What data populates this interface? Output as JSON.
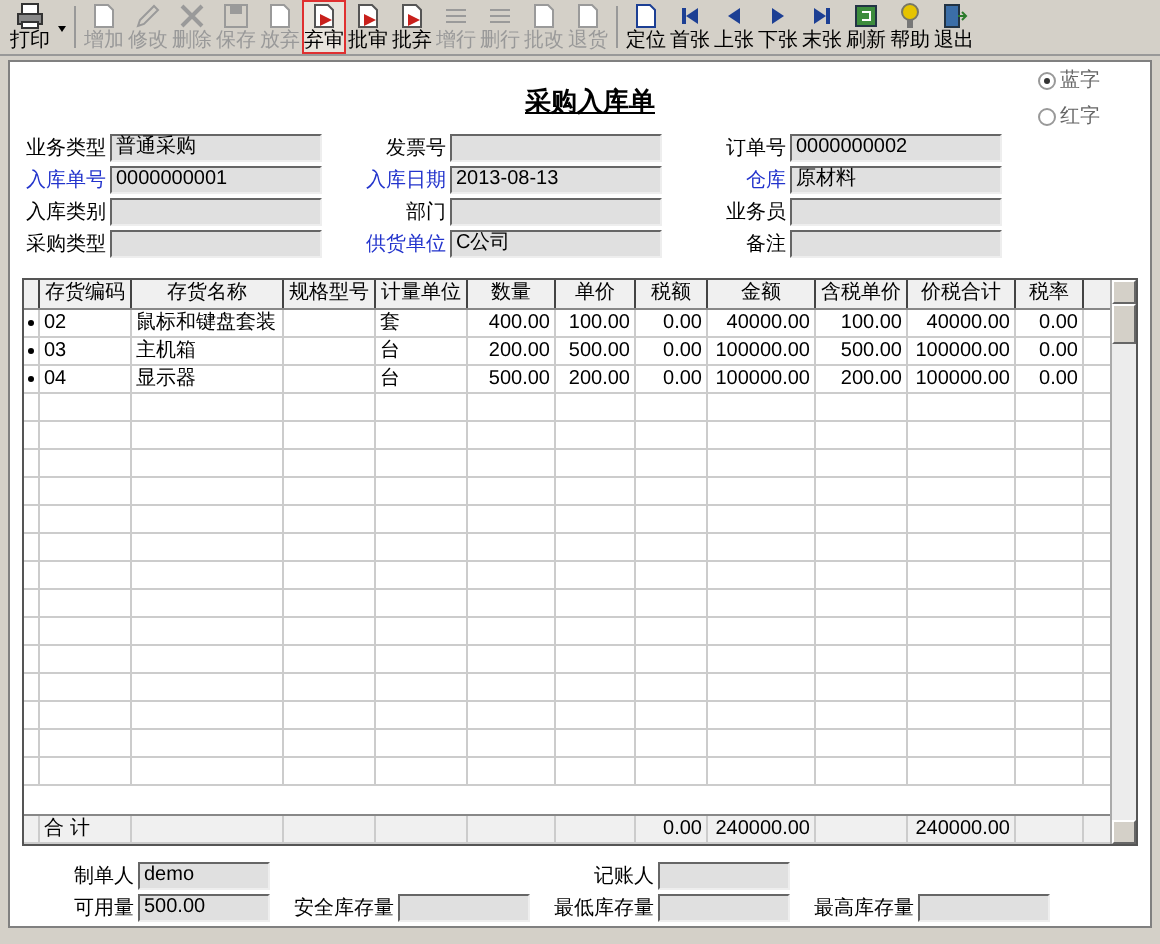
{
  "toolbar": [
    {
      "label": "打印",
      "disabled": false,
      "highlighted": false,
      "dropdown": true
    },
    {
      "label": "增加",
      "disabled": true,
      "highlighted": false,
      "dropdown": false
    },
    {
      "label": "修改",
      "disabled": true,
      "highlighted": false,
      "dropdown": false
    },
    {
      "label": "删除",
      "disabled": true,
      "highlighted": false,
      "dropdown": false
    },
    {
      "label": "保存",
      "disabled": true,
      "highlighted": false,
      "dropdown": false
    },
    {
      "label": "放弃",
      "disabled": true,
      "highlighted": false,
      "dropdown": false
    },
    {
      "label": "弃审",
      "disabled": false,
      "highlighted": true,
      "dropdown": false
    },
    {
      "label": "批审",
      "disabled": false,
      "highlighted": false,
      "dropdown": false
    },
    {
      "label": "批弃",
      "disabled": false,
      "highlighted": false,
      "dropdown": false
    },
    {
      "label": "增行",
      "disabled": true,
      "highlighted": false,
      "dropdown": false
    },
    {
      "label": "删行",
      "disabled": true,
      "highlighted": false,
      "dropdown": false
    },
    {
      "label": "批改",
      "disabled": true,
      "highlighted": false,
      "dropdown": false
    },
    {
      "label": "退货",
      "disabled": true,
      "highlighted": false,
      "dropdown": false
    },
    {
      "label": "定位",
      "disabled": false,
      "highlighted": false,
      "dropdown": false
    },
    {
      "label": "首张",
      "disabled": false,
      "highlighted": false,
      "dropdown": false
    },
    {
      "label": "上张",
      "disabled": false,
      "highlighted": false,
      "dropdown": false
    },
    {
      "label": "下张",
      "disabled": false,
      "highlighted": false,
      "dropdown": false
    },
    {
      "label": "末张",
      "disabled": false,
      "highlighted": false,
      "dropdown": false
    },
    {
      "label": "刷新",
      "disabled": false,
      "highlighted": false,
      "dropdown": false
    },
    {
      "label": "帮助",
      "disabled": false,
      "highlighted": false,
      "dropdown": false
    },
    {
      "label": "退出",
      "disabled": false,
      "highlighted": false,
      "dropdown": false
    }
  ],
  "form": {
    "title": "采购入库单",
    "color_options": [
      {
        "label": "蓝字",
        "selected": true
      },
      {
        "label": "红字",
        "selected": false
      }
    ],
    "fields": [
      {
        "label": "业务类型",
        "value": "普通采购",
        "required": false
      },
      {
        "label": "发票号",
        "required": false
      },
      {
        "label": "订单号",
        "value": "0000000002",
        "required": false
      },
      {
        "label": "入库单号",
        "value": "0000000001",
        "required": true
      },
      {
        "label": "入库日期",
        "value": "2013-08-13",
        "required": true
      },
      {
        "label": "仓库",
        "value": "原材料",
        "required": true
      },
      {
        "label": "入库类别",
        "required": false
      },
      {
        "label": "部门",
        "required": false
      },
      {
        "label": "业务员",
        "required": false
      },
      {
        "label": "采购类型",
        "required": false
      },
      {
        "label": "供货单位",
        "value": "C公司",
        "required": true
      },
      {
        "label": "备注",
        "required": false
      }
    ]
  },
  "table": {
    "columns": [
      "存货编码",
      "存货名称",
      "规格型号",
      "计量单位",
      "数量",
      "单价",
      "税额",
      "金额",
      "含税单价",
      "价税合计",
      "税率"
    ],
    "rows": [
      [
        "02",
        "鼠标和键盘套装",
        "",
        "套",
        "400.00",
        "100.00",
        "0.00",
        "40000.00",
        "100.00",
        "40000.00",
        "0.00"
      ],
      [
        "03",
        "主机箱",
        "",
        "台",
        "200.00",
        "500.00",
        "0.00",
        "100000.00",
        "500.00",
        "100000.00",
        "0.00"
      ],
      [
        "04",
        "显示器",
        "",
        "台",
        "500.00",
        "200.00",
        "0.00",
        "100000.00",
        "200.00",
        "100000.00",
        "0.00"
      ]
    ],
    "totals": {
      "label": "合 计",
      "cells": [
        "",
        "",
        "",
        "",
        "",
        "",
        "0.00",
        "240000.00",
        "",
        "240000.00",
        ""
      ]
    }
  },
  "footer": {
    "rows": [
      [
        {
          "label": "制单人",
          "value": "demo"
        },
        "",
        {
          "label": "记账人"
        }
      ],
      [
        {
          "label": "可用量",
          "value": "500.00"
        },
        {
          "label": "安全库存量"
        },
        {
          "label": "最低库存量"
        },
        {
          "label": "最高库存量"
        }
      ]
    ]
  }
}
